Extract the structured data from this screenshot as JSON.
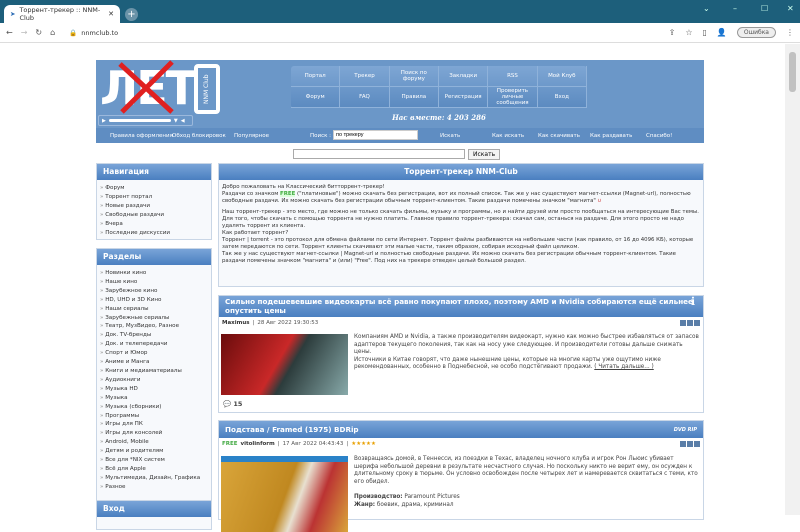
{
  "browser": {
    "tab_title": "Торрент-трекер :: NNM-Club",
    "url": "nnmclub.to",
    "error_label": "Ошибка"
  },
  "header": {
    "logo_text": "ЛЕТО",
    "logo_side": "NNM Club",
    "together": "Нас вместе: 4 203 286",
    "menu": [
      "Портал",
      "Трекер",
      "Поиск по форуму",
      "Закладки",
      "RSS",
      "Мой Клуб",
      "Форум",
      "FAQ",
      "Правила",
      "Регистрация",
      "Проверить личные сообщения",
      "Вход"
    ],
    "nav_left": [
      "Правила оформления",
      "Обход блокировок",
      "Популярное"
    ],
    "search_label": "Поиск :",
    "search_value": "по трекеру",
    "search_button": "Искать",
    "nav_right": [
      "Как искать",
      "Как скачивать",
      "Как раздавать",
      "Спасибо!"
    ]
  },
  "search": {
    "button": "Искать"
  },
  "navigation": {
    "title": "Навигация",
    "items": [
      "Форум",
      "Торрент портал",
      "Новые раздачи",
      "Свободные раздачи",
      "Вчера",
      "Последние дискуссии"
    ]
  },
  "sections": {
    "title": "Разделы",
    "items": [
      "Новинки кино",
      "Наше кино",
      "Зарубежное кино",
      "HD, UHD и 3D Кино",
      "Наши сериалы",
      "Зарубежные сериалы",
      "Театр, МузВидео, Разное",
      "Док. TV-бренды",
      "Док. и телепередачи",
      "Спорт и Юмор",
      "Аниме и Манга",
      "Книги и медиаматериалы",
      "Аудиокниги",
      "Музыка HD",
      "Музыка",
      "Музыка (сборники)",
      "Программы",
      "Игры для ПК",
      "Игры для консолей",
      "Android, Mobile",
      "Детям и родителям",
      "Все для *NIX систем",
      "Всё для Apple",
      "Мультимедиа, Дизайн, Графика",
      "Разное"
    ]
  },
  "login": {
    "title": "Вход"
  },
  "welcome": {
    "title": "Торрент-трекер NNM-Club",
    "p1": "Добро пожаловать на Классический битторрент-трекер!",
    "p2a": "Раздачи со значком",
    "free": "FREE",
    "p2b": "(\"платиновые\") можно скачать без регистрации, вот их полный список. Так же у нас существуют магнет-ссылки (Magnet-url), полностью свободные раздачи. Их можно скачать без регистрации обычным торрент-клиентом. Такие раздачи помечены значком \"магнита\"",
    "p3": "Наш торрент-трекер - это место, где можно не только скачать фильмы, музыку и программы, но и найти друзей или просто пообщаться на интересующие Вас темы. Для того, чтобы скачать с помощью торрента не нужно платить. Главное правило торрент-трекера: скачал сам, останься на раздаче. Для этого просто не надо удалять торрент из клиента.",
    "p4": "Как работает торрент?",
    "p5": "Торрент | torrent - это протокол для обмена файлами по сети Интернет. Торрент файлы разбиваются на небольшие части (как правило, от 16 до 4096 КБ), которые затем передаются по сети. Торрент клиенты скачивают эти малые части, таким образом, собирая исходный файл целиком.",
    "p6": "Так же у нас существуют магнет-ссылки | Magnet-url и полностью свободные раздачи. Их можно скачать без регистрации обычным торрент-клиентом. Такие раздачи помечены значком \"магнита\" и (или) \"Free\". Под них на трекере отведен целый большой раздел."
  },
  "news": [
    {
      "title": "Сильно подешевевшие видеокарты всё равно покупают плохо, поэтому AMD и Nvidia собираются ещё сильнее опустить цены",
      "author": "Maximus",
      "date": "28 Авг 2022 19:30:53",
      "text1": "Компаниям AMD и Nvidia, а также производителям видеокарт, нужно как можно быстрее избавляться от запасов адаптеров текущего поколения, так как на носу уже следующее. И производители готовы дальше снижать цены.",
      "text2": "Источники в Китае говорят, что даже нынешние цены, которые на многие карты уже ощутимо ниже рекомендованных, особенно в Поднебесной, не особо подстёгивают продажи.",
      "more": "( Читать дальше... )",
      "comments": "15"
    },
    {
      "title": "Подстава / Framed (1975) BDRip",
      "free": "FREE",
      "author": "vitolinform",
      "date": "17 Авг 2022 04:43:43",
      "stars": "★★★★★",
      "rating": 5,
      "text1": "Возвращаясь домой, в Теннесси, из поездки в Техас, владелец ночного клуба и игрок Рон Льюис убивает шерифа небольшой деревни в результате несчастного случая. Но поскольку никто не верит ему, он осужден к длительному сроку в тюрьме. Он условно освобожден после четырех лет и намеревается сквитаться с теми, кто его обидел.",
      "prod_label": "Производство:",
      "prod": "Paramount Pictures",
      "genre_label": "Жанр:",
      "genre": "боевик, драма, криминал",
      "badge": "DVD RIP"
    }
  ]
}
